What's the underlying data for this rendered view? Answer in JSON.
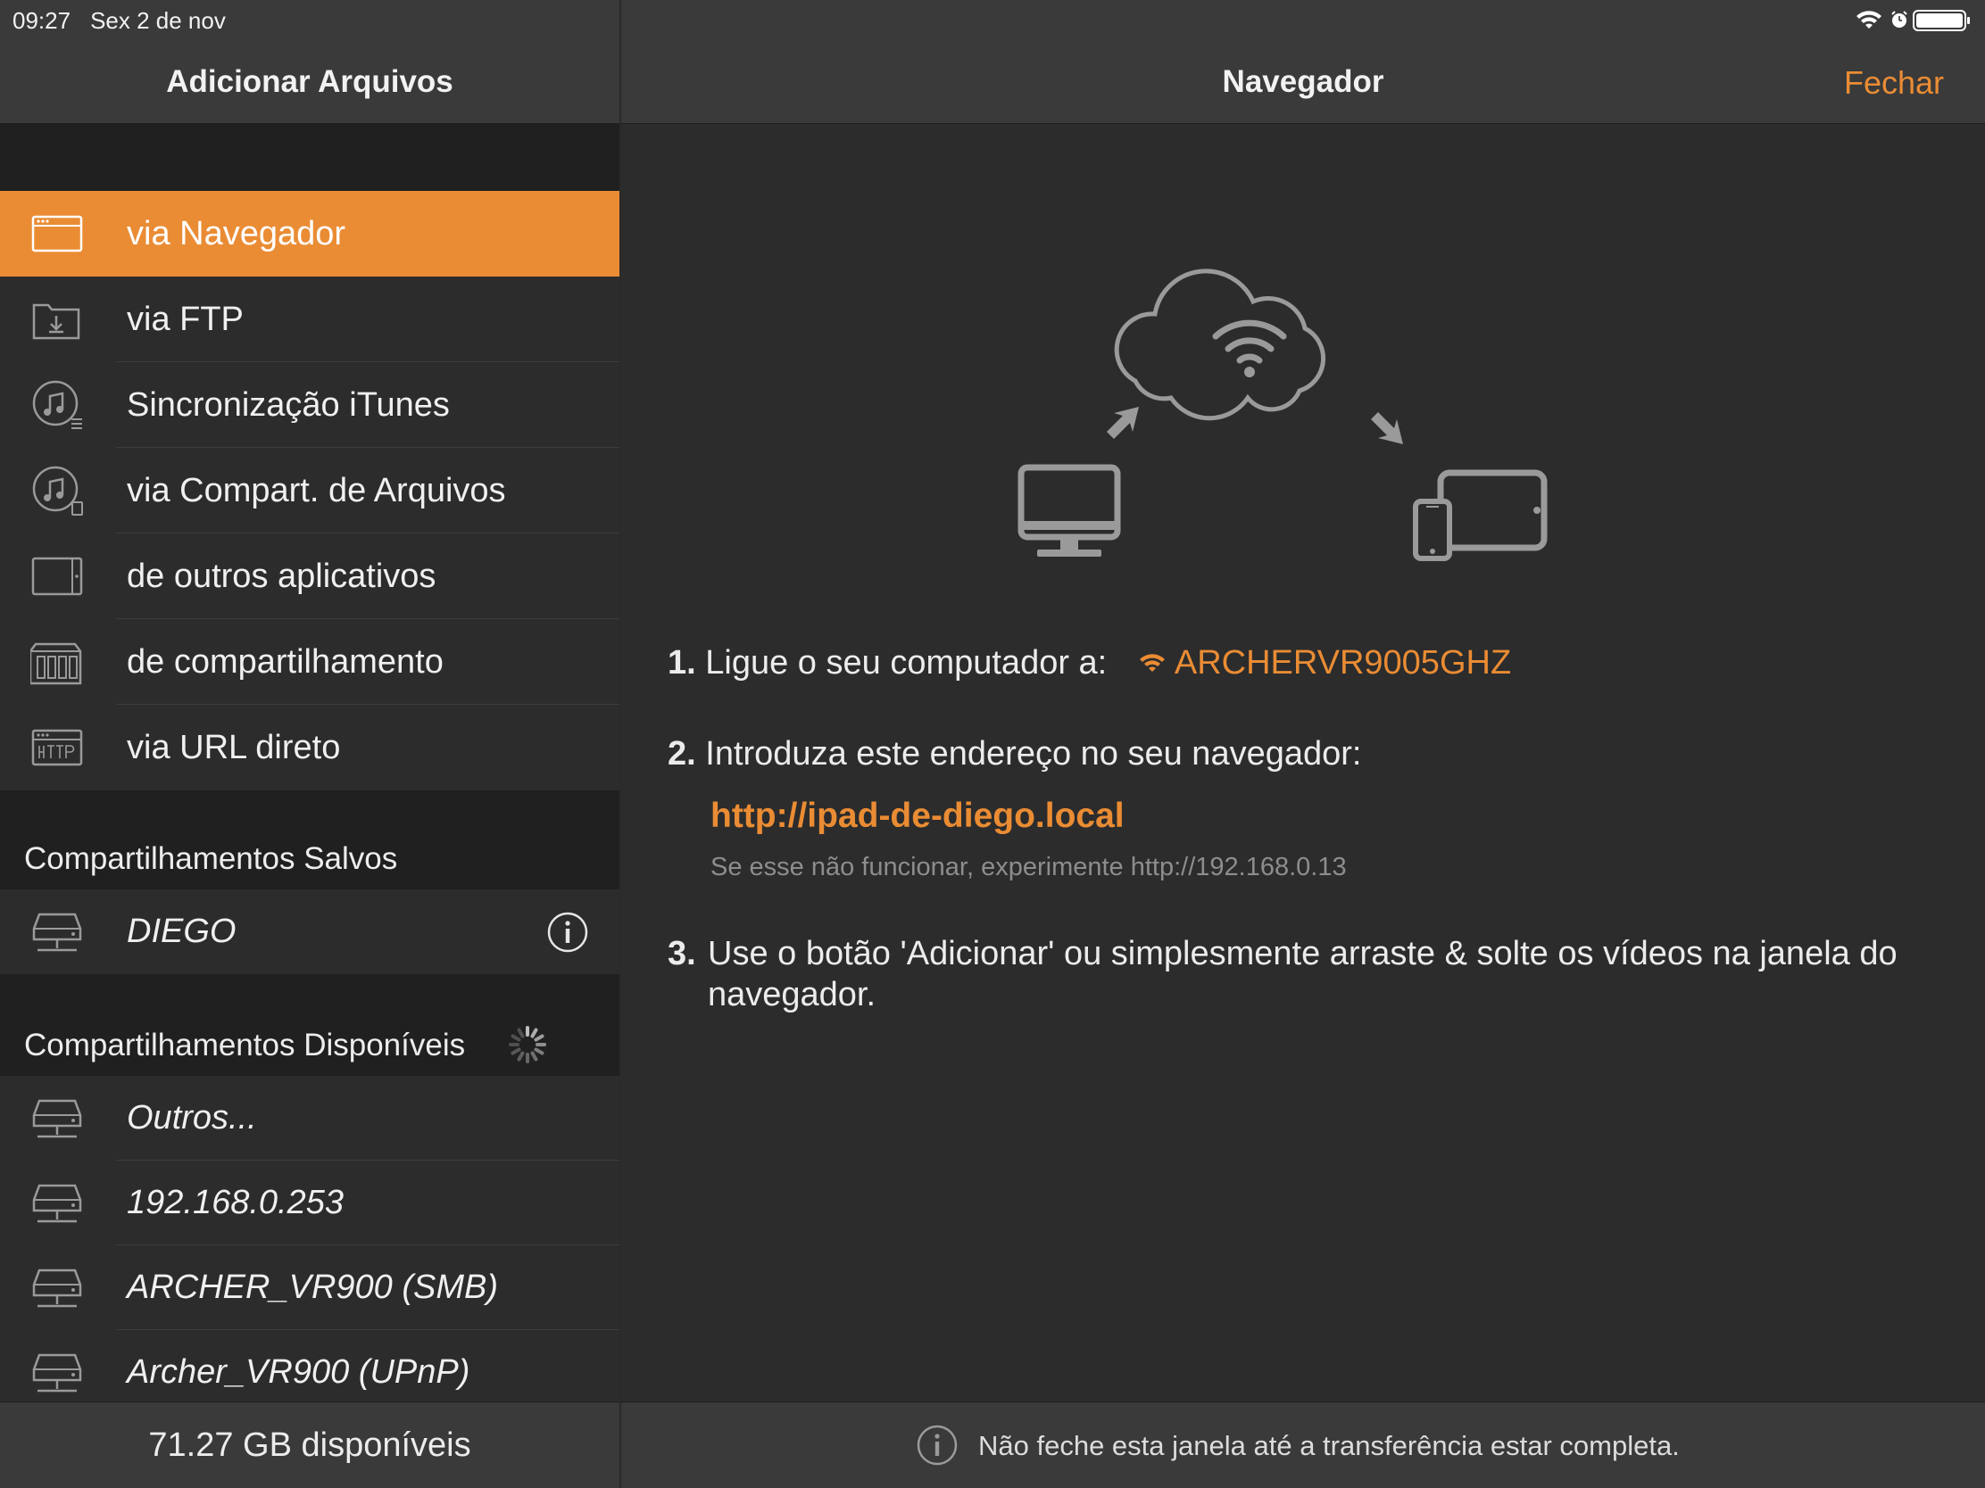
{
  "status_bar": {
    "time": "09:27",
    "date": "Sex 2 de nov"
  },
  "left_panel": {
    "title": "Adicionar Arquivos",
    "menu": [
      {
        "label": "via Navegador",
        "icon": "browser-window-icon",
        "selected": true
      },
      {
        "label": "via FTP",
        "icon": "ftp-folder-icon"
      },
      {
        "label": "Sincronização iTunes",
        "icon": "itunes-sync-icon"
      },
      {
        "label": "via Compart. de Arquivos",
        "icon": "file-sharing-icon"
      },
      {
        "label": "de outros aplicativos",
        "icon": "other-apps-icon"
      },
      {
        "label": "de compartilhamento",
        "icon": "nas-share-icon"
      },
      {
        "label": "via URL direto",
        "icon": "http-url-icon"
      }
    ],
    "saved_header": "Compartilhamentos Salvos",
    "saved": [
      {
        "label": "DIEGO",
        "icon": "server-icon"
      }
    ],
    "available_header": "Compartilhamentos Disponíveis",
    "available": [
      {
        "label": "Outros...",
        "icon": "server-icon"
      },
      {
        "label": "192.168.0.253",
        "icon": "server-icon"
      },
      {
        "label": "ARCHER_VR900 (SMB)",
        "icon": "server-icon"
      },
      {
        "label": "Archer_VR900 (UPnP)",
        "icon": "server-icon"
      }
    ],
    "storage": "71.27 GB disponíveis"
  },
  "right_panel": {
    "title": "Navegador",
    "close_label": "Fechar",
    "step1": {
      "num": "1.",
      "text": "Ligue o seu computador a:",
      "network": "ARCHERVR9005GHZ"
    },
    "step2": {
      "num": "2.",
      "text": "Introduza este endereço no seu navegador:",
      "url": "http://ipad-de-diego.local",
      "hint": "Se esse não funcionar, experimente http://192.168.0.13"
    },
    "step3": {
      "num": "3.",
      "text": "Use o botão 'Adicionar' ou simplesmente arraste & solte os vídeos na janela do navegador."
    },
    "footer_note": "Não feche esta janela até a transferência estar completa."
  },
  "colors": {
    "accent": "#ea8c34",
    "background": "#2c2c2c",
    "header": "#3a3a3a",
    "section": "#202020"
  }
}
